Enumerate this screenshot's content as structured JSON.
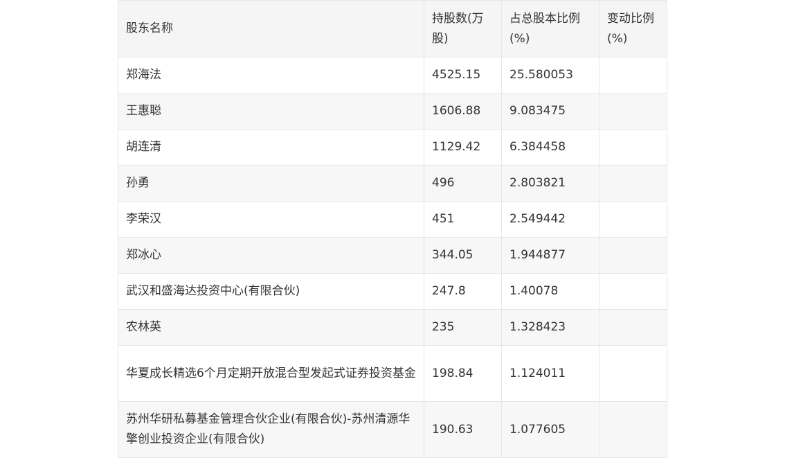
{
  "table": {
    "headers": [
      "股东名称",
      "持股数(万股)",
      "占总股本比例(%)",
      "变动比例(%)"
    ],
    "rows": [
      {
        "name": "郑海法",
        "shares": "4525.15",
        "ratio": "25.580053",
        "change": ""
      },
      {
        "name": "王惠聪",
        "shares": "1606.88",
        "ratio": "9.083475",
        "change": ""
      },
      {
        "name": "胡连清",
        "shares": "1129.42",
        "ratio": "6.384458",
        "change": ""
      },
      {
        "name": "孙勇",
        "shares": "496",
        "ratio": "2.803821",
        "change": ""
      },
      {
        "name": "李荣汉",
        "shares": "451",
        "ratio": "2.549442",
        "change": ""
      },
      {
        "name": "郑冰心",
        "shares": "344.05",
        "ratio": "1.944877",
        "change": ""
      },
      {
        "name": "武汉和盛海达投资中心(有限合伙)",
        "shares": "247.8",
        "ratio": "1.40078",
        "change": ""
      },
      {
        "name": "农林英",
        "shares": "235",
        "ratio": "1.328423",
        "change": ""
      },
      {
        "name": "华夏成长精选6个月定期开放混合型发起式证券投资基金",
        "shares": "198.84",
        "ratio": "1.124011",
        "change": ""
      },
      {
        "name": "苏州华研私募基金管理合伙企业(有限合伙)-苏州清源华擎创业投资企业(有限合伙)",
        "shares": "190.63",
        "ratio": "1.077605",
        "change": ""
      }
    ]
  }
}
